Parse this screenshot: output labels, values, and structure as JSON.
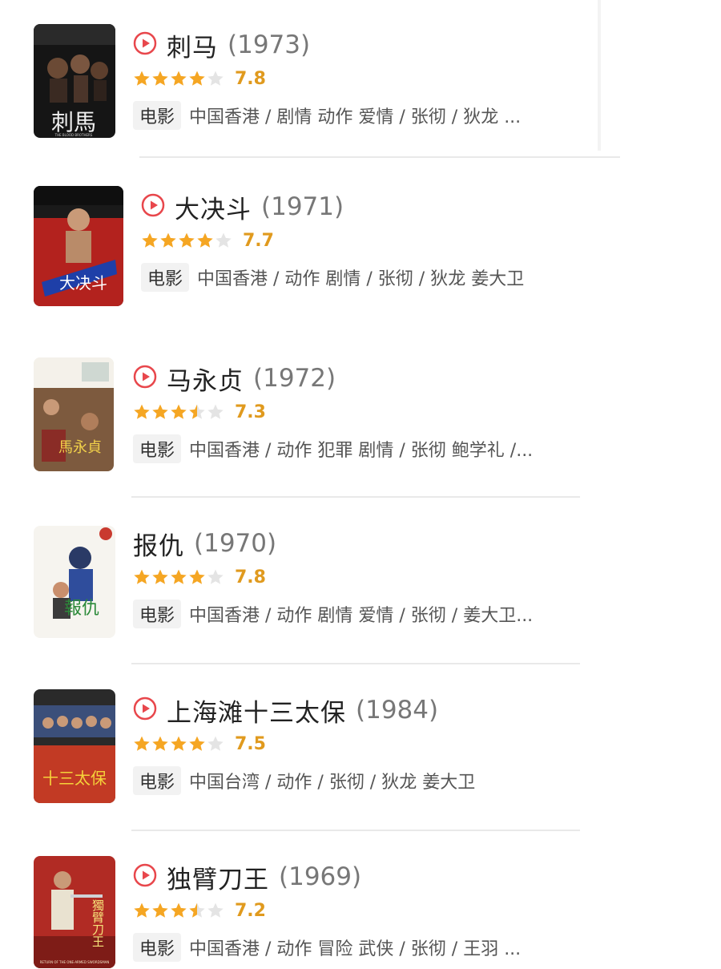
{
  "movies": [
    {
      "title": "刺马",
      "year": "(1973)",
      "rating": 7.8,
      "rating_text": "7.8",
      "stars_filled": 4,
      "stars_half": 0,
      "type": "电影",
      "meta": "中国香港 / 剧情 动作 爱情 / 张彻 / 狄龙 ...",
      "has_play_icon": true,
      "poster_caption": "THE BLOOD BROTHERS",
      "poster_glyphs": "刺馬"
    },
    {
      "title": "大决斗",
      "year": "(1971)",
      "rating": 7.7,
      "rating_text": "7.7",
      "stars_filled": 4,
      "stars_half": 0,
      "type": "电影",
      "meta": "中国香港 / 动作 剧情 / 张彻 / 狄龙 姜大卫",
      "has_play_icon": true,
      "poster_caption": "",
      "poster_glyphs": "大决斗"
    },
    {
      "title": "马永贞",
      "year": "(1972)",
      "rating": 7.3,
      "rating_text": "7.3",
      "stars_filled": 3,
      "stars_half": 1,
      "type": "电影",
      "meta": "中国香港 / 动作 犯罪 剧情 / 张彻 鲍学礼 /...",
      "has_play_icon": true,
      "poster_caption": "",
      "poster_glyphs": "馬永貞"
    },
    {
      "title": "报仇",
      "year": "(1970)",
      "rating": 7.8,
      "rating_text": "7.8",
      "stars_filled": 4,
      "stars_half": 0,
      "type": "电影",
      "meta": "中国香港 / 动作 剧情 爱情 / 张彻 / 姜大卫...",
      "has_play_icon": false,
      "poster_caption": "",
      "poster_glyphs": "報仇"
    },
    {
      "title": "上海滩十三太保",
      "year": "(1984)",
      "rating": 7.5,
      "rating_text": "7.5",
      "stars_filled": 4,
      "stars_half": 0,
      "type": "电影",
      "meta": "中国台湾 / 动作 / 张彻 / 狄龙 姜大卫",
      "has_play_icon": true,
      "poster_caption": "",
      "poster_glyphs": "十三太保"
    },
    {
      "title": "独臂刀王",
      "year": "(1969)",
      "rating": 7.2,
      "rating_text": "7.2",
      "stars_filled": 3,
      "stars_half": 1,
      "type": "电影",
      "meta": "中国香港 / 动作 冒险 武侠 / 张彻 / 王羽 ...",
      "has_play_icon": true,
      "poster_caption": "RETURN OF THE ONE-ARMED SWORDSMAN",
      "poster_glyphs": "獨臂刀王"
    }
  ],
  "colors": {
    "play_icon": "#e8474c",
    "star_filled": "#f5a623",
    "star_empty": "#e4e4e4",
    "score": "#e09a1e"
  },
  "icons": {
    "play": "play-circle-icon",
    "star": "star-icon"
  }
}
